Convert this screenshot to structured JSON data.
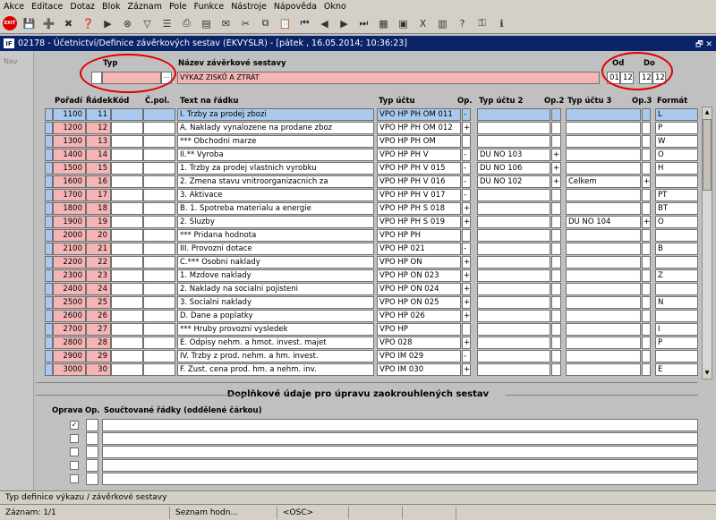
{
  "menu": [
    "Akce",
    "Editace",
    "Dotaz",
    "Blok",
    "Záznam",
    "Pole",
    "Funkce",
    "Nástroje",
    "Nápověda",
    "Okno"
  ],
  "toolbar": {
    "exit_label": "EXIT"
  },
  "window": {
    "title": "02178 - Účetnictví/Definice závěrkových sestav (EKVYSLR) - [pátek , 16.05.2014; 10:36:23]",
    "app_icon": "IF",
    "controls": "🗗 ✕"
  },
  "nav": {
    "label": "Nav"
  },
  "header": {
    "typ_label": "Typ",
    "typ_value": "",
    "lov_button": "···",
    "nazev_label": "Název závěrkové sestavy",
    "nazev_value": "VÝKAZ ZISKŮ A ZTRÁT",
    "od_label": "Od",
    "do_label": "Do",
    "od1": "01",
    "od2": "12",
    "do1": "12",
    "do2": "12"
  },
  "columns": {
    "poradi": "Pořadí",
    "radek": "Řádek",
    "kod": "Kód",
    "cpol": "Č.pol.",
    "text": "Text na řádku",
    "typ_uctu": "Typ účtu",
    "op": "Op.",
    "typ_uctu2": "Typ účtu 2",
    "op2": "Op.2",
    "typ_uctu3": "Typ účtu 3",
    "op3": "Op.3",
    "format": "Formát"
  },
  "rows": [
    {
      "poradi": "1100",
      "radek": "11",
      "text": "I.    Trzby za prodej zbozi",
      "typ": "VPO HP PH OM 011",
      "op": "-",
      "t2": "",
      "op2": "",
      "t3": "",
      "op3": "",
      "fmt": "L"
    },
    {
      "poradi": "1200",
      "radek": "12",
      "text": "A.    Naklady vynalozene na prodane zboz",
      "typ": "VPO HP PH OM 012",
      "op": "+",
      "t2": "",
      "op2": "",
      "t3": "",
      "op3": "",
      "fmt": "P"
    },
    {
      "poradi": "1300",
      "radek": "13",
      "text": "  *** Obchodni marze",
      "typ": "VPO HP PH OM",
      "op": "",
      "t2": "",
      "op2": "",
      "t3": "",
      "op3": "",
      "fmt": "W"
    },
    {
      "poradi": "1400",
      "radek": "14",
      "text": "II.** Vyroba",
      "typ": "VPO HP PH V",
      "op": "-",
      "t2": "DU NO 103",
      "op2": "+",
      "t3": "",
      "op3": "",
      "fmt": "O"
    },
    {
      "poradi": "1500",
      "radek": "15",
      "text": "  1. Trzby za prodej vlastnich vyrobku",
      "typ": "VPO HP PH V 015",
      "op": "-",
      "t2": "DU NO 106",
      "op2": "+",
      "t3": "",
      "op3": "",
      "fmt": "H"
    },
    {
      "poradi": "1600",
      "radek": "16",
      "text": "  2. Zmena stavu vnitroorganizacnich za",
      "typ": "VPO HP PH V 016",
      "op": "-",
      "t2": "DU NO 102",
      "op2": "+",
      "t3": "Celkem",
      "op3": "+",
      "fmt": ""
    },
    {
      "poradi": "1700",
      "radek": "17",
      "text": "  3. Aktivace",
      "typ": "VPO HP PH V 017",
      "op": "-",
      "t2": "",
      "op2": "",
      "t3": "",
      "op3": "",
      "fmt": "PT"
    },
    {
      "poradi": "1800",
      "radek": "18",
      "text": "B. 1. Spotreba materialu a energie",
      "typ": "VPO HP PH S 018",
      "op": "+",
      "t2": "",
      "op2": "",
      "t3": "",
      "op3": "",
      "fmt": "BT"
    },
    {
      "poradi": "1900",
      "radek": "19",
      "text": "  2. Sluzby",
      "typ": "VPO HP PH S 019",
      "op": "+",
      "t2": "",
      "op2": "",
      "t3": "DU NO 104",
      "op3": "+",
      "fmt": "O"
    },
    {
      "poradi": "2000",
      "radek": "20",
      "text": "  *** Pridana hodnota",
      "typ": "VPO HP PH",
      "op": "",
      "t2": "",
      "op2": "",
      "t3": "",
      "op3": "",
      "fmt": ""
    },
    {
      "poradi": "2100",
      "radek": "21",
      "text": "III.  Provozni dotace",
      "typ": "VPO HP 021",
      "op": "-",
      "t2": "",
      "op2": "",
      "t3": "",
      "op3": "",
      "fmt": "B"
    },
    {
      "poradi": "2200",
      "radek": "22",
      "text": "C.*** Osobni naklady",
      "typ": "VPO HP ON",
      "op": "+",
      "t2": "",
      "op2": "",
      "t3": "",
      "op3": "",
      "fmt": ""
    },
    {
      "poradi": "2300",
      "radek": "23",
      "text": "  1. Mzdove naklady",
      "typ": "VPO HP ON 023",
      "op": "+",
      "t2": "",
      "op2": "",
      "t3": "",
      "op3": "",
      "fmt": "Z"
    },
    {
      "poradi": "2400",
      "radek": "24",
      "text": "  2. Naklady na socialni pojisteni",
      "typ": "VPO HP ON 024",
      "op": "+",
      "t2": "",
      "op2": "",
      "t3": "",
      "op3": "",
      "fmt": ""
    },
    {
      "poradi": "2500",
      "radek": "25",
      "text": "  3. Socialni naklady",
      "typ": "VPO HP ON 025",
      "op": "+",
      "t2": "",
      "op2": "",
      "t3": "",
      "op3": "",
      "fmt": "N"
    },
    {
      "poradi": "2600",
      "radek": "26",
      "text": "D.    Dane a poplatky",
      "typ": "VPO HP 026",
      "op": "+",
      "t2": "",
      "op2": "",
      "t3": "",
      "op3": "",
      "fmt": ""
    },
    {
      "poradi": "2700",
      "radek": "27",
      "text": "  *** Hruby provozni vysledek",
      "typ": "VPO HP",
      "op": "",
      "t2": "",
      "op2": "",
      "t3": "",
      "op3": "",
      "fmt": "I"
    },
    {
      "poradi": "2800",
      "radek": "28",
      "text": "E.    Odpisy nehm. a hmot. invest. majet",
      "typ": "VPO 028",
      "op": "+",
      "t2": "",
      "op2": "",
      "t3": "",
      "op3": "",
      "fmt": "P"
    },
    {
      "poradi": "2900",
      "radek": "29",
      "text": "IV.   Trzby z prod. nehm. a hm. invest.",
      "typ": "VPO IM 029",
      "op": "-",
      "t2": "",
      "op2": "",
      "t3": "",
      "op3": "",
      "fmt": ""
    },
    {
      "poradi": "3000",
      "radek": "30",
      "text": "F.    Zust. cena prod. hm. a nehm. inv.",
      "typ": "VPO IM 030",
      "op": "+",
      "t2": "",
      "op2": "",
      "t3": "",
      "op3": "",
      "fmt": "E"
    }
  ],
  "lower": {
    "section_title": "Doplňkové údaje pro úpravu zaokrouhlených sestav",
    "col_oprava": "Oprava",
    "col_op": "Op.",
    "col_rows": "Součtované řádky (oddělené čárkou)",
    "rows": [
      {
        "checked": "✓"
      },
      {
        "checked": ""
      },
      {
        "checked": ""
      },
      {
        "checked": ""
      },
      {
        "checked": ""
      }
    ]
  },
  "hint": "Typ definice výkazu / závěrkové sestavy",
  "status": {
    "record": "Záznam: 1/1",
    "list": "Seznam hodn...",
    "osc": "<OSC>"
  }
}
